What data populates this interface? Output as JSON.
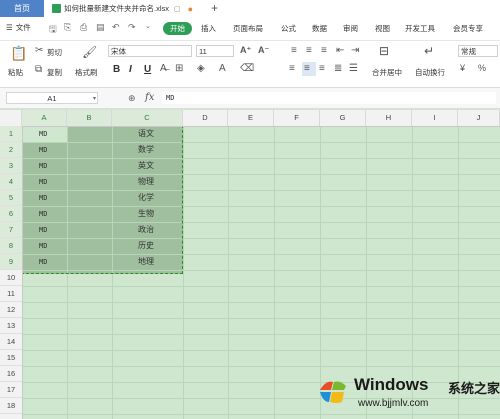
{
  "titlebar": {
    "home_tab": "首页",
    "file_tab": "如何批量新建文件夹并命名.xlsx"
  },
  "menu": {
    "file": "文件",
    "start": "开始",
    "tabs": [
      "插入",
      "页面布局",
      "公式",
      "数据",
      "审阅",
      "视图",
      "开发工具",
      "会员专享"
    ]
  },
  "ribbon": {
    "paste": "粘贴",
    "cut": "剪切",
    "copy": "复制",
    "format_painter": "格式刷",
    "font_name": "宋体",
    "font_size": "11",
    "merge_center": "合并居中",
    "wrap_text": "自动换行",
    "number_format": "常规",
    "format_buttons": [
      "B",
      "I",
      "U"
    ]
  },
  "formula_bar": {
    "name_box": "A1",
    "fx": "fx",
    "value": "MD"
  },
  "columns": [
    "A",
    "B",
    "C",
    "D",
    "E",
    "F",
    "G",
    "H",
    "I",
    "J"
  ],
  "rows": [
    "1",
    "2",
    "3",
    "4",
    "5",
    "6",
    "7",
    "8",
    "9",
    "10",
    "11",
    "12",
    "13",
    "14",
    "15",
    "16",
    "17",
    "18"
  ],
  "cells": {
    "col_a": [
      "MD",
      "MD",
      "MD",
      "MD",
      "MD",
      "MD",
      "MD",
      "MD",
      "MD"
    ],
    "col_c": [
      "语文",
      "数学",
      "英文",
      "物理",
      "化学",
      "生物",
      "政治",
      "历史",
      "地理"
    ]
  },
  "watermark": {
    "brand": "Windows",
    "brand_cn": "系统之家",
    "url": "www.bjjmlv.com"
  }
}
